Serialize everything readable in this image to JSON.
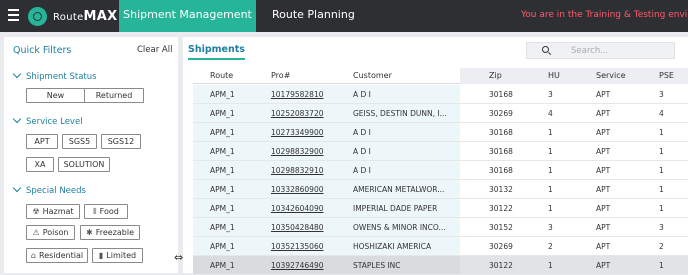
{
  "topbar": {
    "logo": {
      "name": "RouteMAX",
      "prefix": "Route",
      "suffix": "MAX"
    },
    "tabs": [
      {
        "label": "Shipment Management",
        "active": true
      },
      {
        "label": "Route Planning",
        "active": false
      }
    ],
    "notice": "You are in the Training & Testing envir",
    "notice_color": "#ff5a6b",
    "accent_color": "#27b59a"
  },
  "filters": {
    "title": "Quick Filters",
    "clear_label": "Clear All",
    "sections": [
      {
        "title": "Shipment Status",
        "chips": [
          {
            "label": "New"
          },
          {
            "label": "Returned"
          }
        ]
      },
      {
        "title": "Service Level",
        "chips": [
          {
            "label": "APT"
          },
          {
            "label": "SGS5"
          },
          {
            "label": "SGS12"
          },
          {
            "label": "XA"
          },
          {
            "label": "SOLUTION"
          }
        ]
      },
      {
        "title": "Special Needs",
        "chips": [
          {
            "label": "Hazmat",
            "icon": "☢"
          },
          {
            "label": "Food",
            "icon": "⦀"
          },
          {
            "label": "Poison",
            "icon": "⚠"
          },
          {
            "label": "Freezable",
            "icon": "✱"
          },
          {
            "label": "Residential",
            "icon": "⌂"
          },
          {
            "label": "Limited",
            "icon": "▮"
          }
        ]
      }
    ]
  },
  "main": {
    "tab_label": "Shipments",
    "search_placeholder": "Search...",
    "columns": [
      "Route",
      "Pro#",
      "Customer",
      "Zip",
      "HU",
      "Service",
      "PSE"
    ],
    "rows": [
      {
        "route": "APM_1",
        "pro": "10179582810",
        "customer": "A D I",
        "zip": "30168",
        "hu": "3",
        "service": "APT",
        "pse": "3"
      },
      {
        "route": "APM_1",
        "pro": "10252083720",
        "customer": "GEISS, DESTIN DUNN, I...",
        "zip": "30269",
        "hu": "4",
        "service": "APT",
        "pse": "4"
      },
      {
        "route": "APM_1",
        "pro": "10273349900",
        "customer": "A D I",
        "zip": "30168",
        "hu": "1",
        "service": "APT",
        "pse": "1"
      },
      {
        "route": "APM_1",
        "pro": "10298832900",
        "customer": "A D I",
        "zip": "30168",
        "hu": "1",
        "service": "APT",
        "pse": "1"
      },
      {
        "route": "APM_1",
        "pro": "10298832910",
        "customer": "A D I",
        "zip": "30168",
        "hu": "1",
        "service": "APT",
        "pse": "1"
      },
      {
        "route": "APM_1",
        "pro": "10332860900",
        "customer": "AMERICAN METALWOR...",
        "zip": "30132",
        "hu": "1",
        "service": "APT",
        "pse": "1"
      },
      {
        "route": "APM_1",
        "pro": "10342604090",
        "customer": "IMPERIAL DADE PAPER",
        "zip": "30122",
        "hu": "1",
        "service": "APT",
        "pse": "1"
      },
      {
        "route": "APM_1",
        "pro": "10350428480",
        "customer": "OWENS & MINOR INCO...",
        "zip": "30152",
        "hu": "3",
        "service": "APT",
        "pse": "3"
      },
      {
        "route": "APM_1",
        "pro": "10352135060",
        "customer": "HOSHIZAKI AMERICA",
        "zip": "30269",
        "hu": "2",
        "service": "APT",
        "pse": "2"
      },
      {
        "route": "APM_1",
        "pro": "10392746490",
        "customer": "STAPLES INC",
        "zip": "30122",
        "hu": "1",
        "service": "APT",
        "pse": "1"
      }
    ]
  }
}
